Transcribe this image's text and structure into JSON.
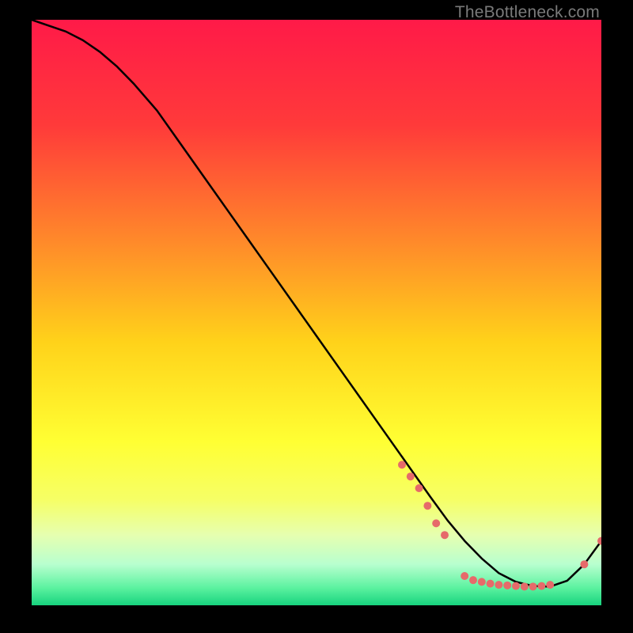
{
  "watermark": "TheBottleneck.com",
  "chart_data": {
    "type": "line",
    "title": "",
    "xlabel": "",
    "ylabel": "",
    "xlim": [
      0,
      100
    ],
    "ylim": [
      0,
      100
    ],
    "grid": false,
    "legend": false,
    "background_gradient": {
      "stops": [
        {
          "offset": 0.0,
          "color": "#ff1a48"
        },
        {
          "offset": 0.18,
          "color": "#ff3a3a"
        },
        {
          "offset": 0.38,
          "color": "#ff8a2a"
        },
        {
          "offset": 0.55,
          "color": "#ffd21a"
        },
        {
          "offset": 0.72,
          "color": "#ffff33"
        },
        {
          "offset": 0.82,
          "color": "#f6ff66"
        },
        {
          "offset": 0.88,
          "color": "#e6ffb0"
        },
        {
          "offset": 0.93,
          "color": "#b8ffcf"
        },
        {
          "offset": 0.97,
          "color": "#5cf2a0"
        },
        {
          "offset": 1.0,
          "color": "#17d37e"
        }
      ]
    },
    "series": [
      {
        "name": "curve",
        "color": "#000000",
        "x": [
          0,
          3,
          6,
          9,
          12,
          15,
          18,
          22,
          26,
          30,
          34,
          38,
          42,
          46,
          50,
          54,
          58,
          62,
          66,
          70,
          73,
          76,
          79,
          82,
          85,
          88,
          91,
          94,
          97,
          100
        ],
        "y": [
          100,
          99,
          98,
          96.5,
          94.5,
          92,
          89,
          84.5,
          79,
          73.5,
          68,
          62.5,
          57,
          51.5,
          46,
          40.5,
          35,
          29.5,
          24,
          18.5,
          14.5,
          11,
          8,
          5.5,
          4,
          3.3,
          3.2,
          4.2,
          7,
          11
        ]
      }
    ],
    "marker_points": {
      "color": "#e66a6a",
      "radius": 5,
      "points": [
        {
          "x": 65,
          "y": 24
        },
        {
          "x": 66.5,
          "y": 22
        },
        {
          "x": 68,
          "y": 20
        },
        {
          "x": 69.5,
          "y": 17
        },
        {
          "x": 71,
          "y": 14
        },
        {
          "x": 72.5,
          "y": 12
        },
        {
          "x": 76,
          "y": 5
        },
        {
          "x": 77.5,
          "y": 4.3
        },
        {
          "x": 79,
          "y": 4
        },
        {
          "x": 80.5,
          "y": 3.7
        },
        {
          "x": 82,
          "y": 3.5
        },
        {
          "x": 83.5,
          "y": 3.4
        },
        {
          "x": 85,
          "y": 3.3
        },
        {
          "x": 86.5,
          "y": 3.2
        },
        {
          "x": 88,
          "y": 3.2
        },
        {
          "x": 89.5,
          "y": 3.3
        },
        {
          "x": 91,
          "y": 3.5
        },
        {
          "x": 97,
          "y": 7
        },
        {
          "x": 100,
          "y": 11
        }
      ]
    }
  }
}
